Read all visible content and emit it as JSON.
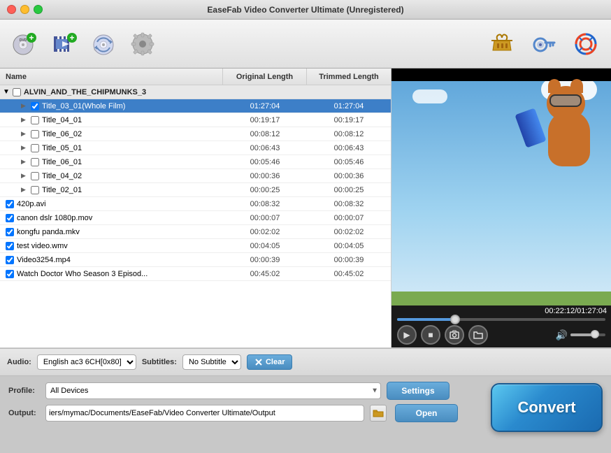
{
  "window": {
    "title": "EaseFab Video Converter Ultimate (Unregistered)"
  },
  "toolbar": {
    "buttons": [
      {
        "id": "add-dvd",
        "label": "Add DVD",
        "icon": "💿"
      },
      {
        "id": "add-video",
        "label": "Add Video",
        "icon": "🎬"
      },
      {
        "id": "add-iso",
        "label": "Add ISO",
        "icon": "💿"
      },
      {
        "id": "settings-main",
        "label": "Settings",
        "icon": "⚙️"
      }
    ],
    "right_buttons": [
      {
        "id": "basket",
        "label": "Basket",
        "icon": "🧺"
      },
      {
        "id": "key",
        "label": "Register",
        "icon": "🔑"
      },
      {
        "id": "help",
        "label": "Help",
        "icon": "🛟"
      }
    ]
  },
  "file_list": {
    "headers": {
      "name": "Name",
      "original": "Original Length",
      "trimmed": "Trimmed Length"
    },
    "group": {
      "name": "ALVIN_AND_THE_CHIPMUNKS_3",
      "expanded": true
    },
    "items": [
      {
        "id": "title0301",
        "name": "Title_03_01(Whole Film)",
        "original": "01:27:04",
        "trimmed": "01:27:04",
        "checked": true,
        "selected": true,
        "indent": 2
      },
      {
        "id": "title0401",
        "name": "Title_04_01",
        "original": "00:19:17",
        "trimmed": "00:19:17",
        "checked": false,
        "selected": false,
        "indent": 2
      },
      {
        "id": "title0602",
        "name": "Title_06_02",
        "original": "00:08:12",
        "trimmed": "00:08:12",
        "checked": false,
        "selected": false,
        "indent": 2
      },
      {
        "id": "title0501",
        "name": "Title_05_01",
        "original": "00:06:43",
        "trimmed": "00:06:43",
        "checked": false,
        "selected": false,
        "indent": 2
      },
      {
        "id": "title0601",
        "name": "Title_06_01",
        "original": "00:05:46",
        "trimmed": "00:05:46",
        "checked": false,
        "selected": false,
        "indent": 2
      },
      {
        "id": "title0402",
        "name": "Title_04_02",
        "original": "00:00:36",
        "trimmed": "00:00:36",
        "checked": false,
        "selected": false,
        "indent": 2
      },
      {
        "id": "title0201",
        "name": "Title_02_01",
        "original": "00:00:25",
        "trimmed": "00:00:25",
        "checked": false,
        "selected": false,
        "indent": 2
      }
    ],
    "flat_items": [
      {
        "id": "420p",
        "name": "420p.avi",
        "original": "00:08:32",
        "trimmed": "00:08:32",
        "checked": true
      },
      {
        "id": "canon",
        "name": "canon dslr 1080p.mov",
        "original": "00:00:07",
        "trimmed": "00:00:07",
        "checked": true
      },
      {
        "id": "kongfu",
        "name": "kongfu panda.mkv",
        "original": "00:02:02",
        "trimmed": "00:02:02",
        "checked": true
      },
      {
        "id": "test",
        "name": "test video.wmv",
        "original": "00:04:05",
        "trimmed": "00:04:05",
        "checked": true
      },
      {
        "id": "video3254",
        "name": "Video3254.mp4",
        "original": "00:00:39",
        "trimmed": "00:00:39",
        "checked": true
      },
      {
        "id": "doctor",
        "name": "Watch Doctor Who Season 3 Episod...",
        "original": "00:45:02",
        "trimmed": "00:45:02",
        "checked": true
      }
    ]
  },
  "preview": {
    "time_display": "00:22:12/01:27:04",
    "progress_percent": 28
  },
  "audio_bar": {
    "audio_label": "Audio:",
    "audio_value": "English ac3 6CH[0x80]",
    "subtitle_label": "Subtitles:",
    "subtitle_value": "No Subtitle",
    "clear_label": "Clear"
  },
  "profile_bar": {
    "profile_label": "Profile:",
    "profile_value": "All Devices",
    "output_label": "Output:",
    "output_value": "iers/mymac/Documents/EaseFab/Video Converter Ultimate/Output"
  },
  "actions": {
    "settings_label": "Settings",
    "open_label": "Open",
    "convert_label": "Convert"
  }
}
